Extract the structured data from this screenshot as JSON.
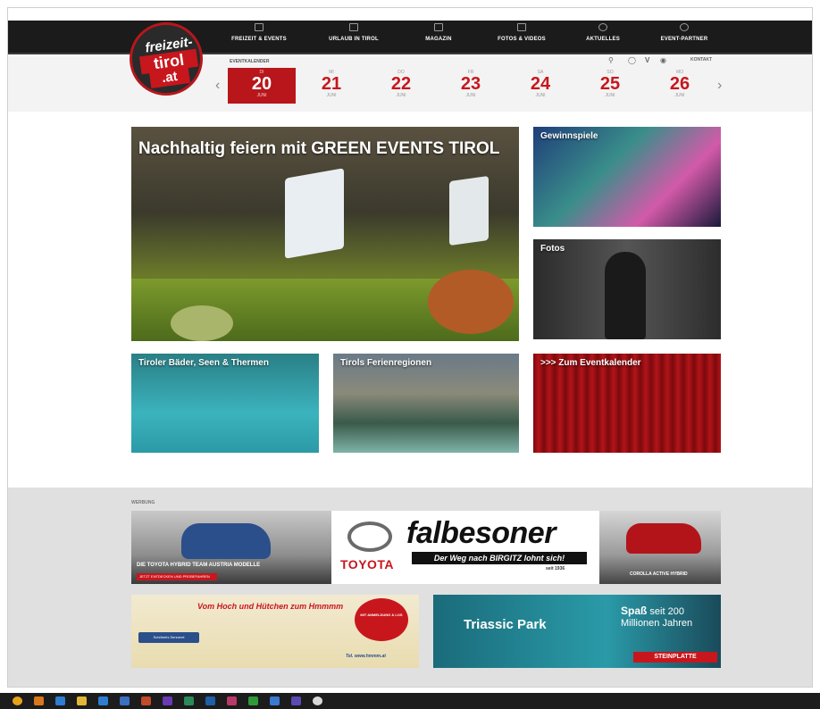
{
  "nav": {
    "items": [
      {
        "label": "FREIZEIT & EVENTS",
        "icon": "calendar-icon"
      },
      {
        "label": "URLAUB IN TIROL",
        "icon": "bed-icon"
      },
      {
        "label": "MAGAZIN",
        "icon": "book-icon"
      },
      {
        "label": "FOTOS & VIDEOS",
        "icon": "camera-icon"
      },
      {
        "label": "AKTUELLES",
        "icon": "megaphone-icon"
      },
      {
        "label": "EVENT-PARTNER",
        "icon": "heart-icon"
      }
    ]
  },
  "logo": {
    "line1": "freizeit-",
    "line2": "tirol",
    "line3": ".at"
  },
  "datebar": {
    "label": "EVENTKALENDER",
    "kontakt": "KONTAKT",
    "dates": [
      {
        "weekday": "DI",
        "day": "20",
        "month": "JUNI",
        "active": true
      },
      {
        "weekday": "MI",
        "day": "21",
        "month": "JUNI"
      },
      {
        "weekday": "DO",
        "day": "22",
        "month": "JUNI"
      },
      {
        "weekday": "FR",
        "day": "23",
        "month": "JUNI"
      },
      {
        "weekday": "SA",
        "day": "24",
        "month": "JUNI"
      },
      {
        "weekday": "SO",
        "day": "25",
        "month": "JUNI"
      },
      {
        "weekday": "MO",
        "day": "26",
        "month": "JUNI"
      }
    ],
    "prev": "‹",
    "next": "›"
  },
  "tiles": {
    "hero": "Nachhaltig feiern mit GREEN EVENTS TIROL",
    "gewinnspiele": "Gewinnspiele",
    "fotos": "Fotos",
    "baeder": "Tiroler Bäder, Seen & Thermen",
    "regionen": "Tirols Ferienregionen",
    "eventkalender": ">>> Zum Eventkalender"
  },
  "werbung": {
    "label": "WERBUNG",
    "car1": {
      "text": "DIE TOYOTA HYBRID TEAM AUSTRIA MODELLE",
      "button": "JETZT ENTDECKEN UND PROBEFAHREN"
    },
    "toyota": {
      "brand": "TOYOTA",
      "dealer": "falbesoner",
      "slogan": "Der Weg nach BIRGITZ lohnt sich!",
      "since": "seit 1936"
    },
    "car2": {
      "text": "COROLLA ACTIVE HYBRID"
    },
    "spar": {
      "headline": "Vom Hoch und Hütchen zum Hmmmm",
      "tag": "Schöberls Sennerei",
      "badge": "MIT ANMELDUNG & LOS",
      "foot": "Tel. www.hmmm.at"
    },
    "triassic": {
      "name": "Triassic Park",
      "spass_bold": "Spaß",
      "spass_rest": "seit 200 Millionen Jahren",
      "steinplatte": "STEINPLATTE"
    }
  },
  "colors": {
    "accent": "#c8161d",
    "nav_bg": "#1b1b1b",
    "werbung_bg": "#e0e0e0"
  }
}
